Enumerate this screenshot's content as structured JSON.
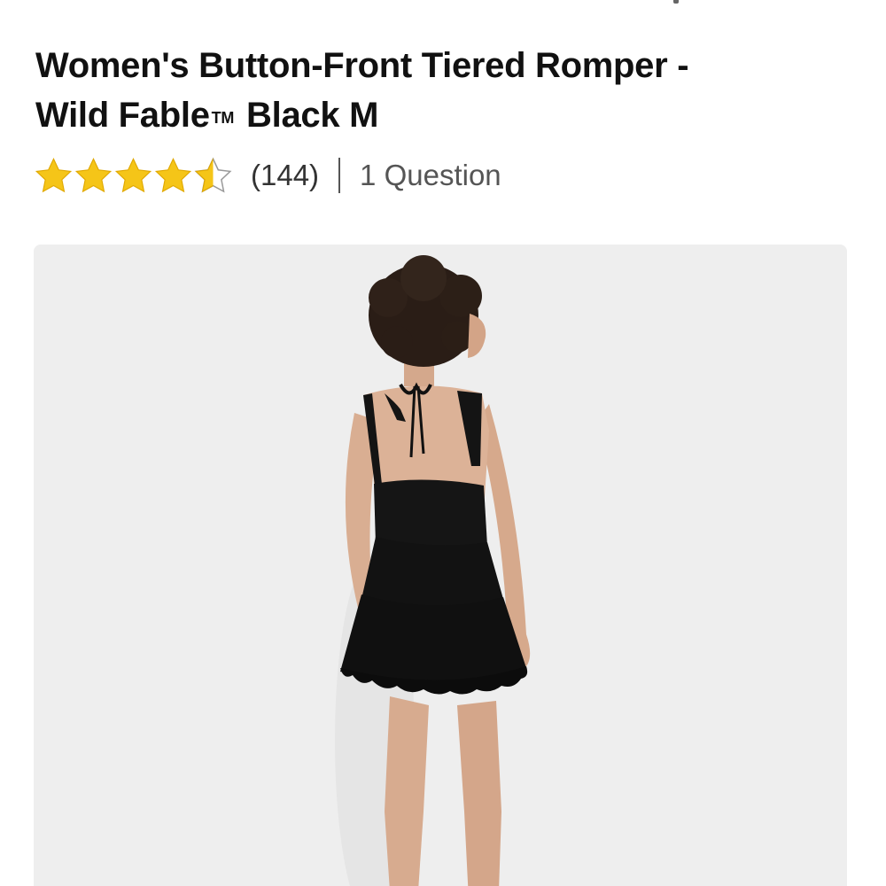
{
  "product": {
    "title_line1": "Women's Button-Front Tiered Romper -",
    "title_brand": "Wild Fable",
    "title_trademark": "TM",
    "title_variant": "Black M"
  },
  "rating": {
    "stars": 4.5,
    "max_stars": 5,
    "star_color": "#F5C518",
    "review_count": "(144)",
    "questions_label": "1 Question"
  },
  "image": {
    "description_icon": "product-photo",
    "background_color": "#EEEEEE",
    "garment_color": "#111111"
  }
}
